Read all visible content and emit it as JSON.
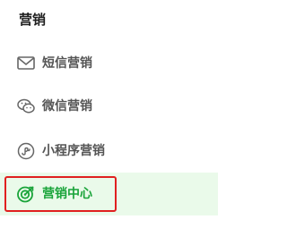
{
  "section": {
    "title": "营销"
  },
  "items": [
    {
      "label": "短信营销",
      "icon": "mail-icon",
      "active": false
    },
    {
      "label": "微信营销",
      "icon": "wechat-icon",
      "active": false
    },
    {
      "label": "小程序营销",
      "icon": "mini-program-icon",
      "active": false
    },
    {
      "label": "营销中心",
      "icon": "target-icon",
      "active": true
    }
  ],
  "colors": {
    "active_text": "#1aa43a",
    "active_bg": "#eafaea",
    "inactive_text": "#555555",
    "highlight_border": "#e02020"
  }
}
